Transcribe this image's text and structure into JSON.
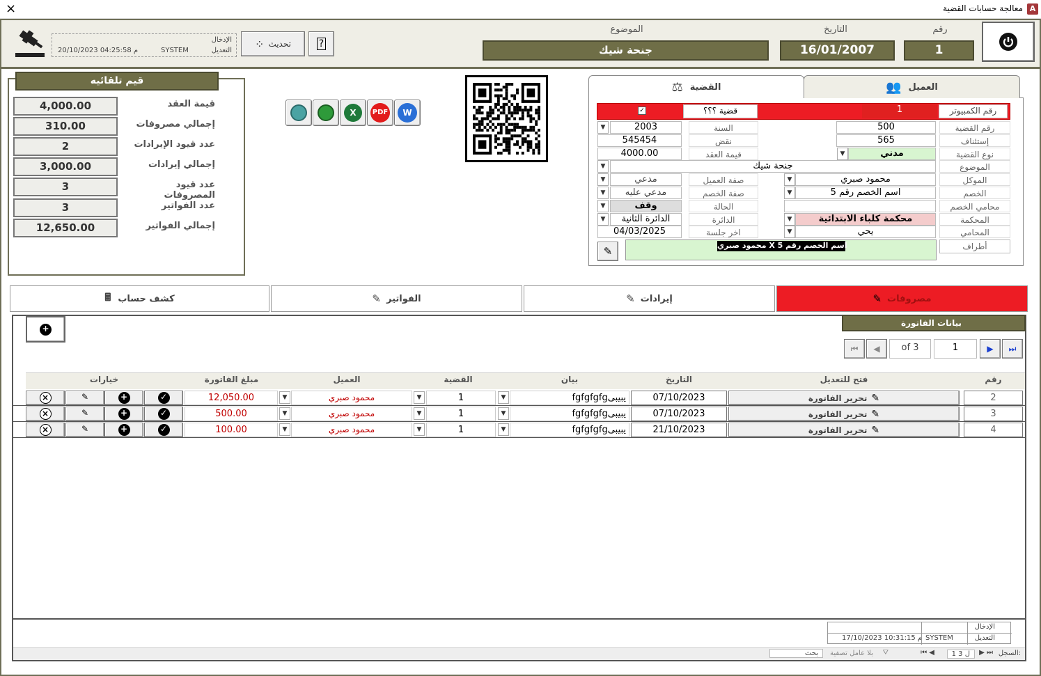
{
  "window": {
    "title": "معالجة حسابات القضية",
    "app_letter": "A",
    "close": "×"
  },
  "header": {
    "num_label": "رقم",
    "num_value": "1",
    "date_label": "التاريخ",
    "date_value": "16/01/2007",
    "subject_label": "الموضوع",
    "subject_value": "جنحة شيك",
    "refresh_label": "تحديث",
    "audit_entry_label": "الإدخال",
    "audit_edit_label": "التعديل",
    "audit_user": "SYSTEM",
    "audit_date": "20/10/2023 04:25:58 م"
  },
  "auto_values": {
    "title": "قيم تلقائيه",
    "rows": [
      {
        "label": "قيمة العقد",
        "value": "4,000.00"
      },
      {
        "label": "إجمالي مصروفات",
        "value": "310.00"
      },
      {
        "label": "عدد قيود الإيرادات",
        "value": "2"
      },
      {
        "label": "إجمالي إيرادات",
        "value": "3,000.00"
      },
      {
        "label": "عدد قيود المصروفات",
        "value": "3"
      },
      {
        "label": "عدد الفواتير",
        "value": "3"
      },
      {
        "label": "إجمالي الفواتير",
        "value": "12,650.00"
      }
    ]
  },
  "export": {
    "pdf": "PDF",
    "word": "W",
    "excel": "X"
  },
  "case_tabs": {
    "client": "العميل",
    "case": "القضية"
  },
  "case": {
    "computer_num_label": "رقم الكمبيوتر",
    "computer_num": "1",
    "case_type_text": "قضية ؟؟؟",
    "case_num_label": "رقم القضية",
    "case_num": "500",
    "year_label": "السنة",
    "year": "2003",
    "appeal_label": "إستئناف",
    "appeal": "565",
    "cassation_label": "نقض",
    "cassation": "545454",
    "case_kind_label": "نوع القضية",
    "case_kind": "مدني",
    "contract_label": "قيمة العقد",
    "contract": "4000.00",
    "subject_label": "الموضوع",
    "subject": "جنحة شيك",
    "client_label": "الموكل",
    "client": "محمود صبري",
    "client_role_label": "صفة العميل",
    "client_role": "مدعي",
    "opponent_label": "الخصم",
    "opponent": "اسم الخصم رقم 5",
    "opponent_role_label": "صفة الخصم",
    "opponent_role": "مدعي عليه",
    "opp_lawyer_label": "محامي الخصم",
    "status_label": "الحالة",
    "status": "وقف",
    "court_label": "المحكمة",
    "court": "محكمة كلباء الابتدائية",
    "circuit_label": "الدائرة",
    "circuit": "الدائرة الثانية",
    "lawyer_label": "المحامي",
    "lawyer": "يحي",
    "last_session_label": "اخر جلسة",
    "last_session": "04/03/2025",
    "parties_label": "أطراف",
    "parties": "محمود صبري   X   اسم الخصم رقم 5"
  },
  "main_tabs": {
    "expenses": "مصروفات",
    "revenues": "إيرادات",
    "invoices": "الفواتير",
    "statement": "كشف حساب"
  },
  "invoices": {
    "panel_title": "بيانات الفاتورة",
    "nav": {
      "current": "1",
      "of": "of 3"
    },
    "headers": {
      "num": "رقم",
      "open": "فتح للتعديل",
      "date": "التاريخ",
      "desc": "بيان",
      "case": "القضية",
      "client": "العميل",
      "amount": "مبلغ الفاتورة",
      "options": "خيارات"
    },
    "rows": [
      {
        "num": "2",
        "open": "تحرير الفاتورة",
        "date": "07/10/2023",
        "desc": "fgfgfgfgيبيبى",
        "case": "1",
        "client": "محمود صبري",
        "amount": "12,050.00"
      },
      {
        "num": "3",
        "open": "تحرير الفاتورة",
        "date": "07/10/2023",
        "desc": "fgfgfgfgيبيبى",
        "case": "1",
        "client": "محمود صبري",
        "amount": "500.00"
      },
      {
        "num": "4",
        "open": "تحرير الفاتورة",
        "date": "21/10/2023",
        "desc": "fgfgfgfgيبيبى",
        "case": "1",
        "client": "محمود صبري",
        "amount": "100.00"
      }
    ],
    "audit_entry_label": "الإدخال",
    "audit_edit_label": "التعديل",
    "audit_user": "SYSTEM",
    "audit_date": "17/10/2023 10:31:15 م"
  },
  "record_bar": {
    "label": "السجل:",
    "position": "1 ل 3",
    "filter": "بلا عامل تصفية",
    "search": "بحث"
  },
  "colors": {
    "olive": "#6f6e47",
    "red": "#ed1c24",
    "green_light": "#d8f5d0",
    "pink": "#f4cccc",
    "amount_red": "#c00000"
  }
}
